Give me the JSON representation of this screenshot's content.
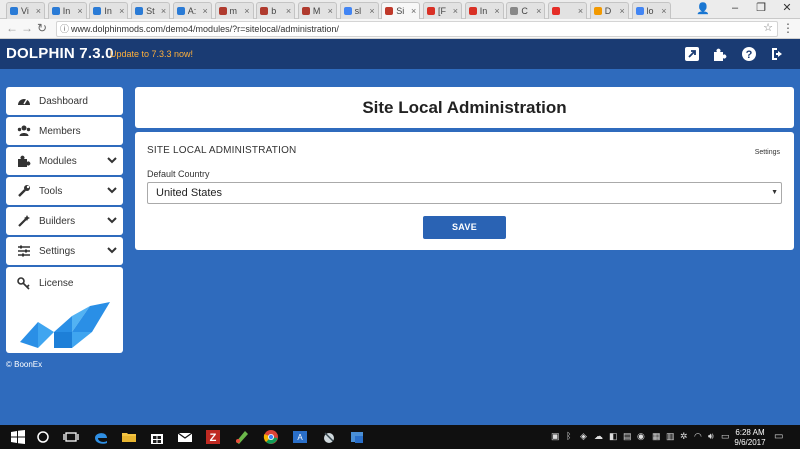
{
  "browser": {
    "tabs": [
      {
        "label": "Vi",
        "fav": "#2a7bd6"
      },
      {
        "label": "In",
        "fav": "#2a7bd6"
      },
      {
        "label": "In",
        "fav": "#2a7bd6"
      },
      {
        "label": "St",
        "fav": "#2a7bd6"
      },
      {
        "label": "A:",
        "fav": "#2a7bd6"
      },
      {
        "label": "m",
        "fav": "#b03a2e"
      },
      {
        "label": "b",
        "fav": "#b03a2e"
      },
      {
        "label": "M",
        "fav": "#b03a2e"
      },
      {
        "label": "sl",
        "fav": "#4285f4"
      },
      {
        "label": "Si",
        "fav": "#c0392b"
      },
      {
        "label": "[F",
        "fav": "#d93025"
      },
      {
        "label": "In",
        "fav": "#d93025"
      },
      {
        "label": "C",
        "fav": "#888888"
      },
      {
        "label": "",
        "fav": "#e52d27"
      },
      {
        "label": "D",
        "fav": "#f29900"
      },
      {
        "label": "lo",
        "fav": "#4285f4"
      }
    ],
    "url": "www.dolphinmods.com/demo4/modules/?r=sitelocal/administration/"
  },
  "header": {
    "brand": "DOLPHIN",
    "version": "7.3.0",
    "update_text": "Update to 7.3.3 now!"
  },
  "sidebar": {
    "items": [
      {
        "label": "Dashboard",
        "icon": "dashboard-icon"
      },
      {
        "label": "Members",
        "icon": "users-icon"
      },
      {
        "label": "Modules",
        "icon": "puzzle-icon"
      },
      {
        "label": "Tools",
        "icon": "wrench-icon"
      },
      {
        "label": "Builders",
        "icon": "magic-wand-icon"
      },
      {
        "label": "Settings",
        "icon": "sliders-icon"
      }
    ],
    "license_label": "License",
    "copyright": "© BoonEx"
  },
  "main": {
    "page_title": "Site Local Administration",
    "form_title": "SITE LOCAL ADMINISTRATION",
    "settings_link": "Settings",
    "field_label": "Default Country",
    "selected_country": "United States",
    "save_label": "SAVE"
  },
  "taskbar": {
    "time": "6:28 AM",
    "date": "9/6/2017"
  },
  "colors": {
    "header_bg": "#1a3b73",
    "page_bg": "#2f6bbd",
    "accent": "#2a63b4",
    "update": "#ffb03b"
  }
}
